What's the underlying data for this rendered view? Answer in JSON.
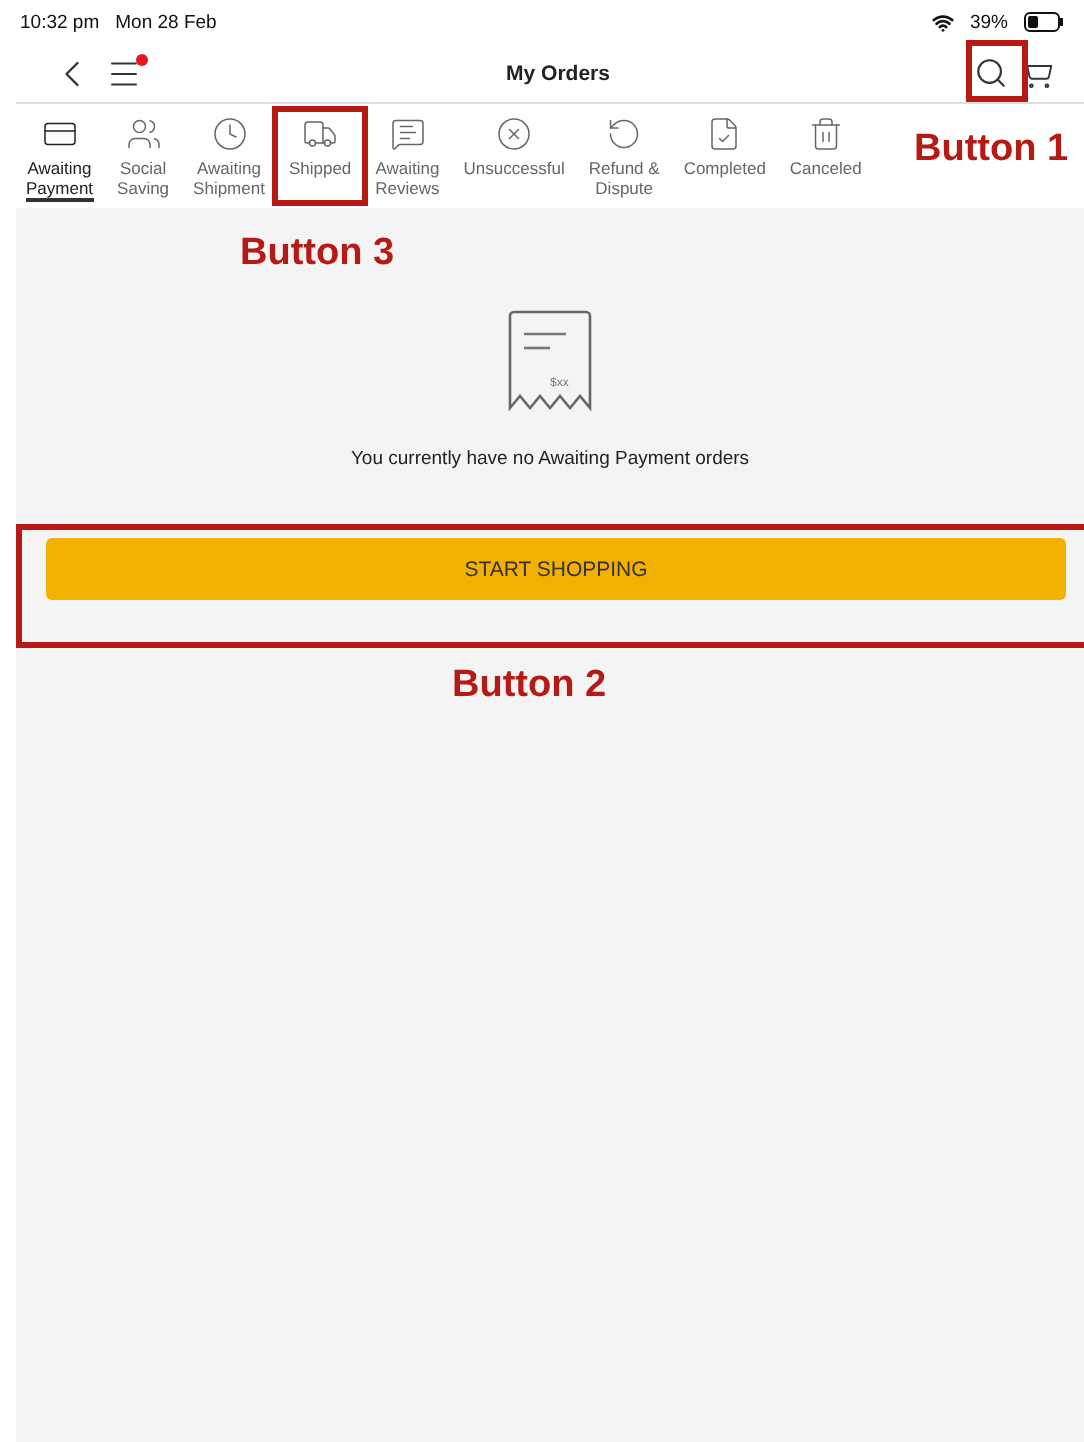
{
  "status_bar": {
    "time": "10:32 pm",
    "date": "Mon 28 Feb",
    "battery": "39%"
  },
  "header": {
    "title": "My Orders",
    "menu_badge": true
  },
  "tabs": [
    {
      "label": "Awaiting\nPayment",
      "selected": true
    },
    {
      "label": "Social\nSaving",
      "selected": false
    },
    {
      "label": "Awaiting\nShipment",
      "selected": false
    },
    {
      "label": "Shipped",
      "selected": false
    },
    {
      "label": "Awaiting\nReviews",
      "selected": false
    },
    {
      "label": "Unsuccessful",
      "selected": false
    },
    {
      "label": "Refund &\nDispute",
      "selected": false
    },
    {
      "label": "Completed",
      "selected": false
    },
    {
      "label": "Canceled",
      "selected": false
    }
  ],
  "empty_state": {
    "receipt_text": "$xx",
    "message": "You currently have no Awaiting Payment orders"
  },
  "button": "START SHOPPING",
  "annotations": [
    {
      "label": "Button 1"
    },
    {
      "label": "Button 2"
    },
    {
      "label": "Button 3"
    }
  ]
}
